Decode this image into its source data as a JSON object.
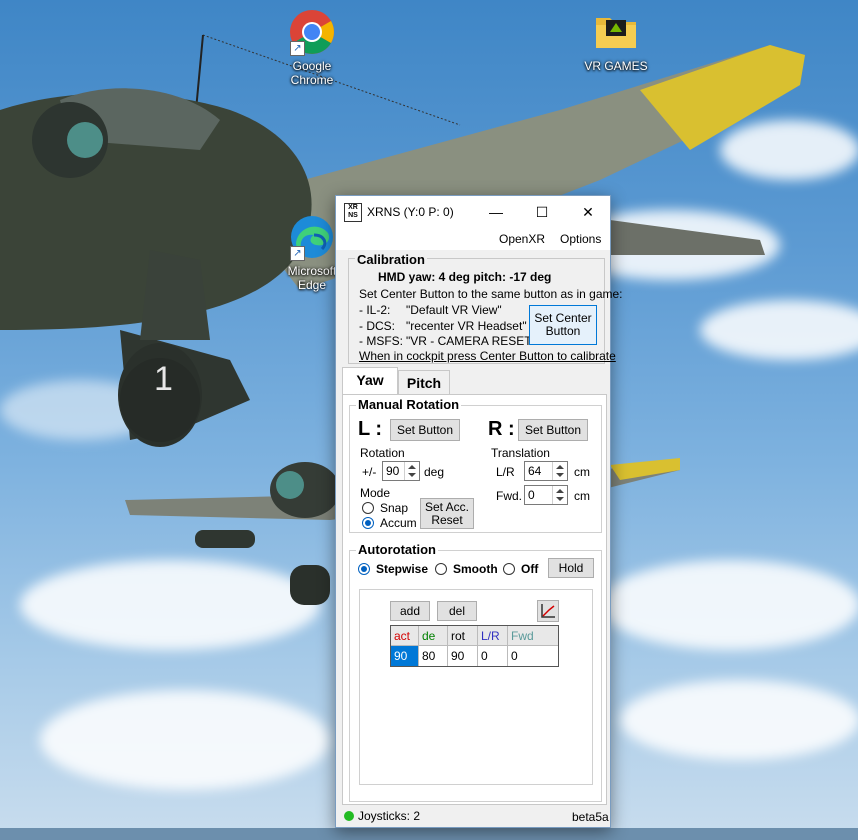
{
  "desktop": {
    "icons": [
      {
        "label": "Google\nChrome",
        "icon": "chrome-icon"
      },
      {
        "label": "VR GAMES",
        "icon": "folder-icon"
      },
      {
        "label": "Microsoft\nEdge",
        "icon": "edge-icon"
      }
    ],
    "airplane_number": "1"
  },
  "window": {
    "title": "XRNS (Y:0  P: 0)",
    "logo_text_top": "XR",
    "logo_text_bottom": "NS",
    "controls": {
      "minimize": "—",
      "maximize": "☐",
      "close": "✕"
    },
    "menu": {
      "openxr": "OpenXR",
      "options": "Options"
    },
    "calibration": {
      "title": "Calibration",
      "hmd": "HMD yaw: 4 deg   pitch: -17 deg",
      "instruction": "Set Center Button to the same button as in game:",
      "games": [
        {
          "name": "-  IL-2:",
          "value": "\"Default VR View\""
        },
        {
          "name": "-  DCS:",
          "value": "\"recenter VR Headset\""
        },
        {
          "name": "-  MSFS:",
          "value": "\"VR - CAMERA RESET\""
        }
      ],
      "set_center_button": "Set Center\nButton",
      "hint": "When in cockpit press Center Button to calibrate"
    },
    "tabs": [
      {
        "label": "Yaw",
        "active": true
      },
      {
        "label": "Pitch",
        "active": false
      }
    ],
    "manual": {
      "title": "Manual Rotation",
      "left_label": "L :",
      "right_label": "R :",
      "set_button": "Set Button",
      "rotation_label": "Rotation",
      "plusminus": "+/-",
      "rotation_value": "90",
      "deg": "deg",
      "translation_label": "Translation",
      "lr_label": "L/R",
      "lr_value": "64",
      "fwd_label": "Fwd.",
      "fwd_value": "0",
      "cm": "cm",
      "mode_label": "Mode",
      "snap": "Snap",
      "accum": "Accum",
      "mode_selected": "Accum",
      "set_acc_reset": "Set Acc.\nReset"
    },
    "autorotation": {
      "title": "Autorotation",
      "options": [
        "Stepwise",
        "Smooth",
        "Off"
      ],
      "selected": "Stepwise",
      "hold": "Hold",
      "add": "add",
      "del": "del",
      "columns": [
        {
          "label": "act",
          "color": "#d40000"
        },
        {
          "label": "de",
          "color": "#008000"
        },
        {
          "label": "rot",
          "color": "#000000"
        },
        {
          "label": "L/R",
          "color": "#3030c0"
        },
        {
          "label": "Fwd",
          "color": "#5a9a9a"
        }
      ],
      "rows": [
        [
          "90",
          "80",
          "90",
          "0",
          "0"
        ]
      ]
    },
    "status": {
      "joysticks": "Joysticks: 2",
      "version": "beta5a",
      "indicator_color": "#22bb22"
    }
  }
}
